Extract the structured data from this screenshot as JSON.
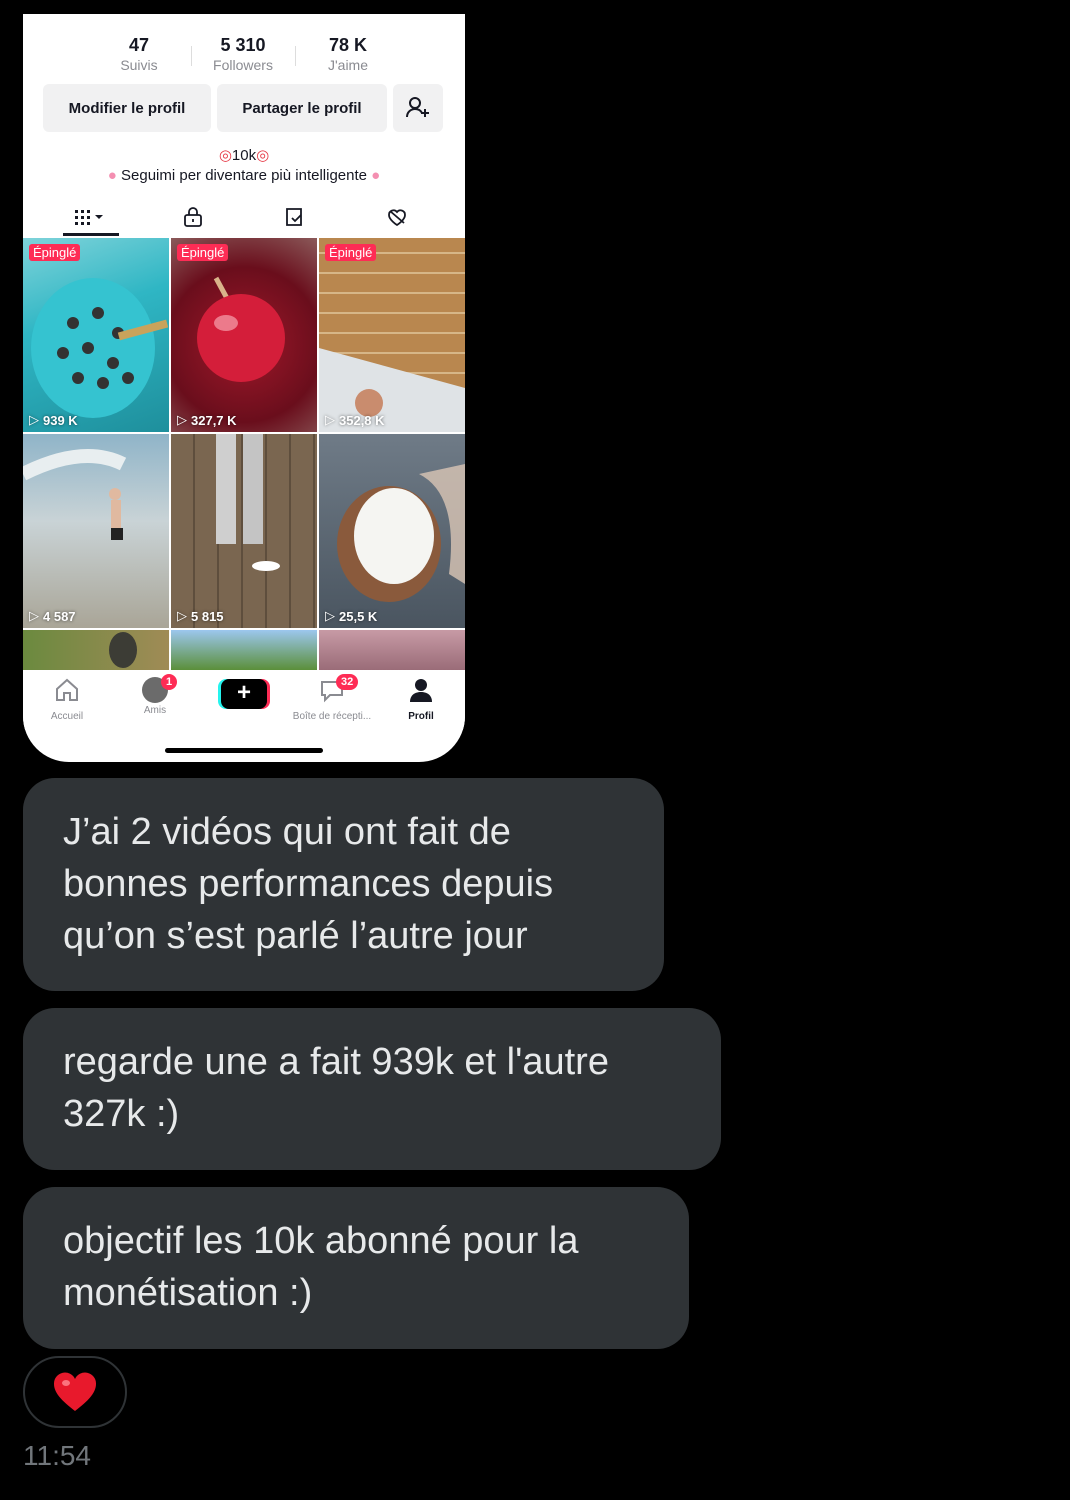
{
  "profile": {
    "stats": [
      {
        "value": "47",
        "label": "Suivis"
      },
      {
        "value": "5 310",
        "label": "Followers"
      },
      {
        "value": "78 K",
        "label": "J'aime"
      }
    ],
    "edit_button": "Modifier le profil",
    "share_button": "Partager le profil",
    "bio_line1": "10k",
    "bio_line2": "Seguimi per diventare più intelligente",
    "tab_icons": [
      "grid-icon",
      "lock-icon",
      "repost-icon",
      "liked-icon"
    ]
  },
  "videos": [
    {
      "pinned": "Épinglé",
      "views": "939 K"
    },
    {
      "pinned": "Épinglé",
      "views": "327,7 K"
    },
    {
      "pinned": "Épinglé",
      "views": "352,8 K"
    },
    {
      "pinned": "",
      "views": "4 587"
    },
    {
      "pinned": "",
      "views": "5 815"
    },
    {
      "pinned": "",
      "views": "25,5 K"
    }
  ],
  "navbar": {
    "home": "Accueil",
    "friends": "Amis",
    "friends_badge": "1",
    "inbox": "Boîte de récepti...",
    "inbox_badge": "32",
    "profile": "Profil"
  },
  "messages": [
    {
      "text": "J’ai 2 vidéos qui ont fait de bonnes performances depuis qu’on s’est parlé l’autre jour"
    },
    {
      "text": "regarde une a fait 939k et l'autre 327k :)"
    },
    {
      "text": "objectif les 10k abonné pour la monétisation :)"
    }
  ],
  "reaction": "❤️",
  "timestamp": "11:54",
  "colors": {
    "accent": "#fe2c55",
    "bubble": "#2f3336",
    "background": "#000000",
    "timestamp": "#71767b"
  }
}
